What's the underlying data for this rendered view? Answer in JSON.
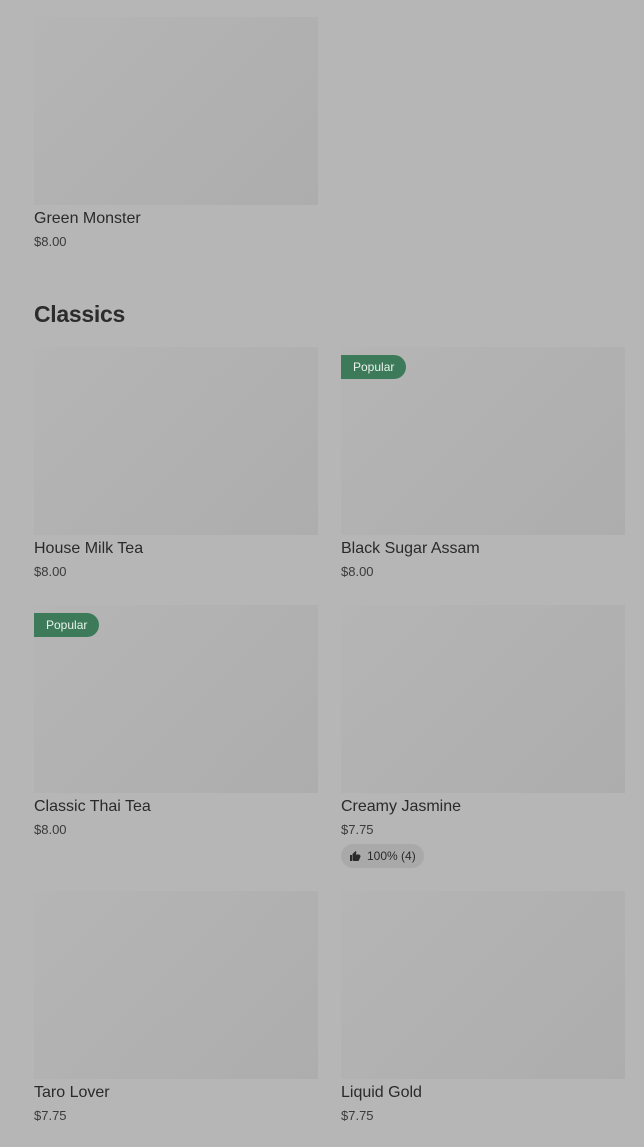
{
  "sections": [
    {
      "items": [
        {
          "name": "Green Monster",
          "price": "$8.00"
        }
      ]
    },
    {
      "title": "Classics",
      "items": [
        {
          "name": "House Milk Tea",
          "price": "$8.00"
        },
        {
          "name": "Black Sugar Assam",
          "price": "$8.00",
          "badge": "Popular"
        },
        {
          "name": "Classic Thai Tea",
          "price": "$8.00",
          "badge": "Popular"
        },
        {
          "name": "Creamy Jasmine",
          "price": "$7.75",
          "rating": "100% (4)",
          "rating_icon": "thumbs-up-icon"
        },
        {
          "name": "Taro Lover",
          "price": "$7.75"
        },
        {
          "name": "Liquid Gold",
          "price": "$7.75"
        }
      ]
    }
  ],
  "colors": {
    "badge_bg": "#3d7a5a",
    "page_bg": "#b6b6b6"
  }
}
